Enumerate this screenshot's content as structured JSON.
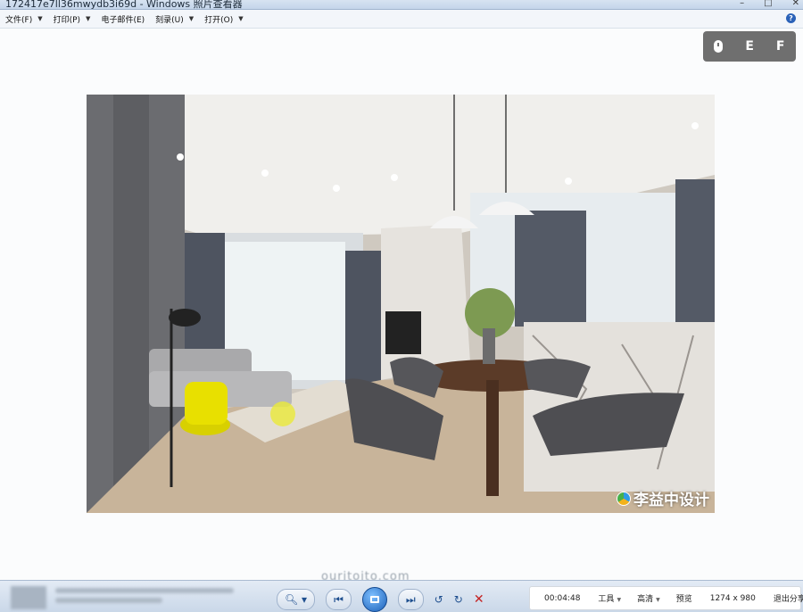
{
  "window": {
    "title": "172417e7ll36mwydb3i69d - Windows 照片查看器",
    "controls": [
      "–",
      "□",
      "✕"
    ]
  },
  "menu": [
    {
      "label": "文件(F)"
    },
    {
      "label": "打印(P)"
    },
    {
      "label": "电子邮件(E)"
    },
    {
      "label": "刻录(U)"
    },
    {
      "label": "打开(O)"
    }
  ],
  "help_icon": "?",
  "overlay_widget": {
    "icon": "mouse-icon",
    "keys": [
      "E",
      "F"
    ]
  },
  "photo": {
    "description_icon": "living-dining-room-photo",
    "watermark": "李益中设计"
  },
  "site_text": "ourjtojto.com",
  "recorder": {
    "time": "00:04:48",
    "tools": "工具",
    "quality": "高清",
    "preview": "预览",
    "resolution": "1274 x 980",
    "exit": "退出分享"
  },
  "colors": {
    "titlebar": "#d7e3f1",
    "menubar": "#f3f6fa",
    "accent": "#1b5fb8",
    "record": "#e03131",
    "delete": "#c42222"
  }
}
